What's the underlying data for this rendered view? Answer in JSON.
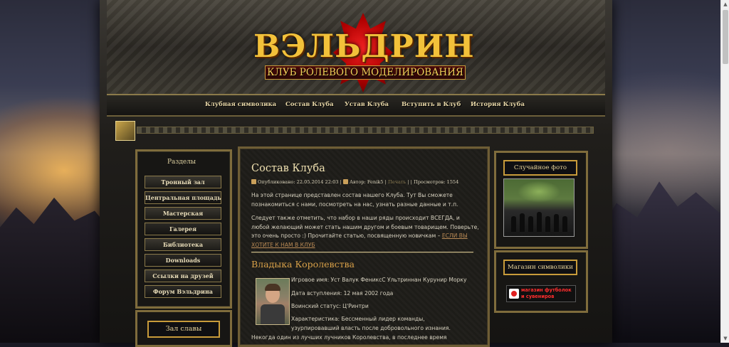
{
  "site": {
    "title": "ВЭЛЬДРИН",
    "subtitle": "КЛУБ РОЛЕВОГО МОДЕЛИРОВАНИЯ"
  },
  "nav": {
    "items": [
      {
        "label": "Клубная символика"
      },
      {
        "label": "Состав Клуба"
      },
      {
        "label": "Устав Клуба"
      },
      {
        "label": "Вступить в Клуб"
      },
      {
        "label": "История Клуба"
      }
    ]
  },
  "sidebar": {
    "title": "Разделы",
    "items": [
      {
        "label": "Тронный зал"
      },
      {
        "label": "Центральная площадь"
      },
      {
        "label": "Мастерская"
      },
      {
        "label": "Галерея"
      },
      {
        "label": "Библиотека"
      },
      {
        "label": "Downloads"
      },
      {
        "label": "Ссылки на друзей"
      },
      {
        "label": "Форум Вэльдрина"
      }
    ],
    "fame_title": "Зал славы"
  },
  "article": {
    "title": "Состав Клуба",
    "published": "Опубликовано: 22.05.2014 22:03",
    "author": "Автор: Fenik5",
    "print": "Печать",
    "views": "Просмотров: 1554",
    "sep": "|",
    "intro": "На этой странице представлен состав нашего Клуба. Тут Вы сможете познакомиться с нами, посмотреть на нас, узнать разные данные и т.п.",
    "recruit": "Следует также отметить, что набор в наши ряды происходит ВСЕГДА, и любой желающий может стать нашим другом и боевым товарищем. Поверьте, это очень просто :) Прочитайте статью, посвященную новичкам –",
    "recruit_link": "ЕСЛИ ВЫ ХОТИТЕ К НАМ В КЛУБ",
    "section_title": "Владыка Королевства",
    "member": {
      "game_name": "Игровое имя: Уст Валук ФениксС Ультриннан Курунир Морку",
      "joined": "Дата вступления: 12 мая 2002 года",
      "rank": "Воинский статус: Ц'Ринтри",
      "trait_line1": "Характеристика: Бессменный лидер команды,",
      "trait_line2": "узурпировавший власть после добровольного изнания.",
      "trait_line3": "Некогда один из лучших лучников Королевства, в последнее время"
    }
  },
  "right": {
    "photo_title": "Случайное фото",
    "shop_title": "Магазин символики",
    "shop_line1": "магазин футболок",
    "shop_line2": "и сувениров"
  },
  "colors": {
    "accent_gold": "#c89b3a",
    "title_red": "#b00000",
    "link_brown": "#b98a55",
    "shop_red": "#ff2d2d"
  }
}
